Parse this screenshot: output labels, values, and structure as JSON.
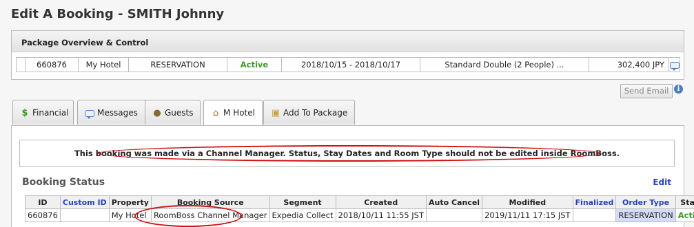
{
  "page": {
    "title": "Edit A Booking - SMITH Johnny"
  },
  "package": {
    "header": "Package Overview & Control",
    "row": {
      "id": "660876",
      "property": "My Hotel",
      "type": "RESERVATION",
      "status": "Active",
      "dates": "2018/10/15 - 2018/10/17",
      "room": "Standard Double (2 People) ...",
      "amount": "302,400 JPY"
    }
  },
  "actions": {
    "send_email": "Send Email",
    "info": "i"
  },
  "tabs": [
    {
      "label": "Financial",
      "icon": "dollar-icon"
    },
    {
      "label": "Messages",
      "icon": "speech-bubble-icon"
    },
    {
      "label": "Guests",
      "icon": "guests-icon"
    },
    {
      "label": "M Hotel",
      "icon": "house-icon"
    },
    {
      "label": "Add To Package",
      "icon": "package-icon"
    }
  ],
  "warning": "This booking was made via a Channel Manager. Status, Stay Dates and Room Type should not be edited inside RoomBoss.",
  "booking_status": {
    "title": "Booking Status",
    "edit_label": "Edit",
    "columns": [
      "ID",
      "Custom ID",
      "Property",
      "Booking Source",
      "Segment",
      "Created",
      "Auto Cancel",
      "Modified",
      "Finalized",
      "Order Type",
      "State"
    ],
    "row": {
      "id": "660876",
      "custom_id": "",
      "property": "My Hotel",
      "source": "RoomBoss Channel Manager",
      "segment": "Expedia Collect",
      "created": "2018/10/11 11:55 JST",
      "auto_cancel": "",
      "modified": "2019/11/11 17:15 JST",
      "finalized": "",
      "order_type": "RESERVATION",
      "state": "Active"
    }
  },
  "colors": {
    "active": "#3a9d1e",
    "link": "#2441c8",
    "highlight": "#d01010"
  }
}
